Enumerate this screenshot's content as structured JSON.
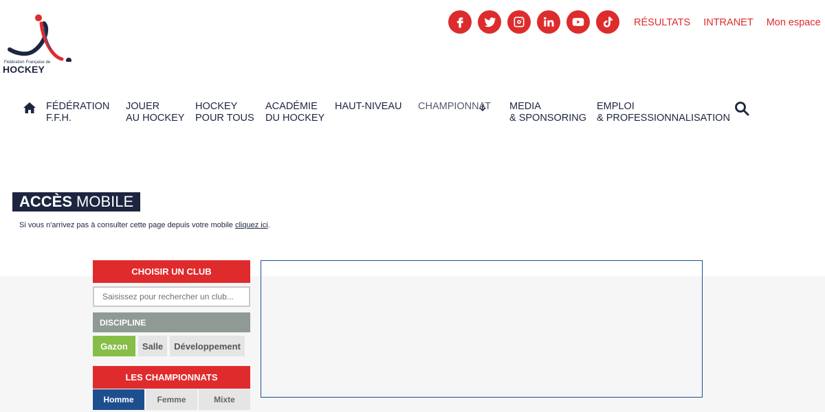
{
  "logo": {
    "small_text": "Fédération Française de",
    "big_text": "HOCKEY"
  },
  "social": [
    {
      "icon": "facebook-icon"
    },
    {
      "icon": "twitter-icon"
    },
    {
      "icon": "instagram-icon"
    },
    {
      "icon": "linkedin-icon"
    },
    {
      "icon": "youtube-icon"
    },
    {
      "icon": "tiktok-icon"
    }
  ],
  "top_links": {
    "resultats": "RÉSULTATS",
    "intranet": "INTRANET",
    "mon_espace": "Mon espace"
  },
  "nav": {
    "federation": [
      "FÉDÉRATION",
      "F.F.H."
    ],
    "jouer": [
      "JOUER",
      "AU HOCKEY"
    ],
    "hockey_pour_tous": [
      "HOCKEY",
      "POUR TOUS"
    ],
    "academie": [
      "ACADÉMIE",
      "DU HOCKEY"
    ],
    "haut_niveau": [
      "HAUT-NIVEAU"
    ],
    "championnat": [
      "CHAMPIONNAT"
    ],
    "media": [
      "MEDIA",
      "& SPONSORING"
    ],
    "emploi": [
      "EMPLOI",
      "& PROFESSIONNALISATION"
    ]
  },
  "acces": {
    "bold": "ACCÈS",
    "light": "MOBILE",
    "note": "Si vous n'arrivez pas à consulter cette page depuis votre mobile",
    "link": "cliquez ici"
  },
  "panel": {
    "choose_club": "CHOISIR UN CLUB",
    "search_placeholder": "Saisissez pour rechercher un club...",
    "discipline": "DISCIPLINE",
    "disciplines": [
      "Gazon",
      "Salle",
      "Développement"
    ],
    "championnats": "LES CHAMPIONNATS",
    "genders": [
      "Homme",
      "Femme",
      "Mixte"
    ]
  },
  "colors": {
    "brand_red": "#dd2c2c",
    "navy": "#1d2540",
    "green_active": "#86be48",
    "blue_active": "#1d4f8f"
  }
}
